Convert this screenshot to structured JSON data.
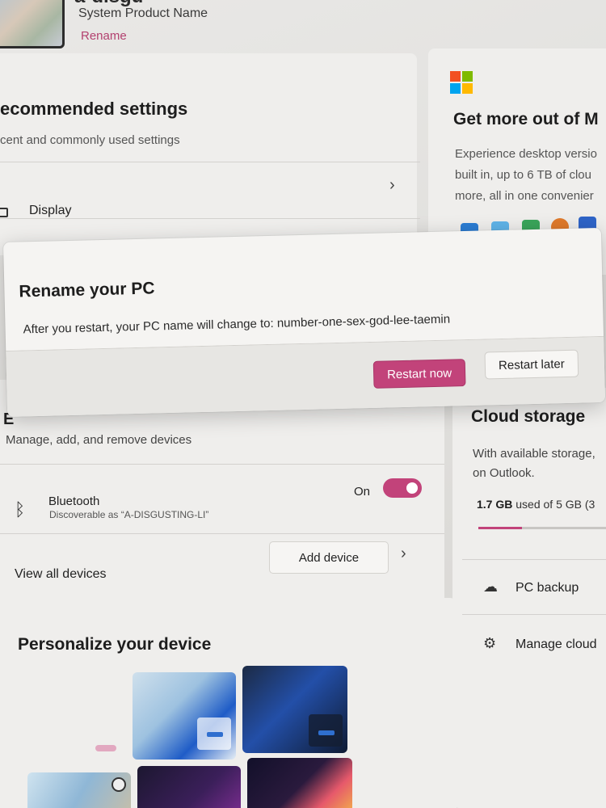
{
  "header": {
    "pc_name_partial": "a-disgu",
    "product_name": "System Product Name",
    "rename_link": "Rename"
  },
  "recommended": {
    "title": "ecommended settings",
    "subtitle": "cent and commonly used settings",
    "display_label": "Display"
  },
  "microsoft_card": {
    "title": "Get more out of M",
    "description_lines": [
      "Experience desktop versio",
      "built in, up to 6 TB of clou",
      "more, all in one convenier"
    ]
  },
  "dialog": {
    "title": "Rename your PC",
    "message": "After you restart, your PC name will change to: number-one-sex-god-lee-taemin",
    "restart_now": "Restart now",
    "restart_later": "Restart later"
  },
  "devices": {
    "title_partial": "E",
    "subtitle": "Manage, add, and remove devices",
    "bluetooth_label": "Bluetooth",
    "bluetooth_sub": "Discoverable as “A-DISGUSTING-LI”",
    "bluetooth_state": "On",
    "add_device": "Add device",
    "view_all": "View all devices"
  },
  "cloud": {
    "title": "Cloud storage",
    "description_lines": [
      "With available storage,",
      "on Outlook."
    ],
    "used_amount": "1.7 GB",
    "used_rest": "used of 5 GB (3",
    "used_fraction": 0.34,
    "pc_backup": "PC backup",
    "manage_cloud": "Manage cloud"
  },
  "personalize": {
    "title": "Personalize your device"
  },
  "colors": {
    "accent": "#c2437a",
    "ms_red": "#f25022",
    "ms_green": "#7fba00",
    "ms_blue": "#00a4ef",
    "ms_yellow": "#ffb900"
  },
  "icons": {
    "bluetooth": "bluetooth-icon",
    "backup": "cloud-upload-icon",
    "manage": "gear-icon",
    "display": "monitor-icon",
    "chevron": "chevron-right-icon"
  }
}
